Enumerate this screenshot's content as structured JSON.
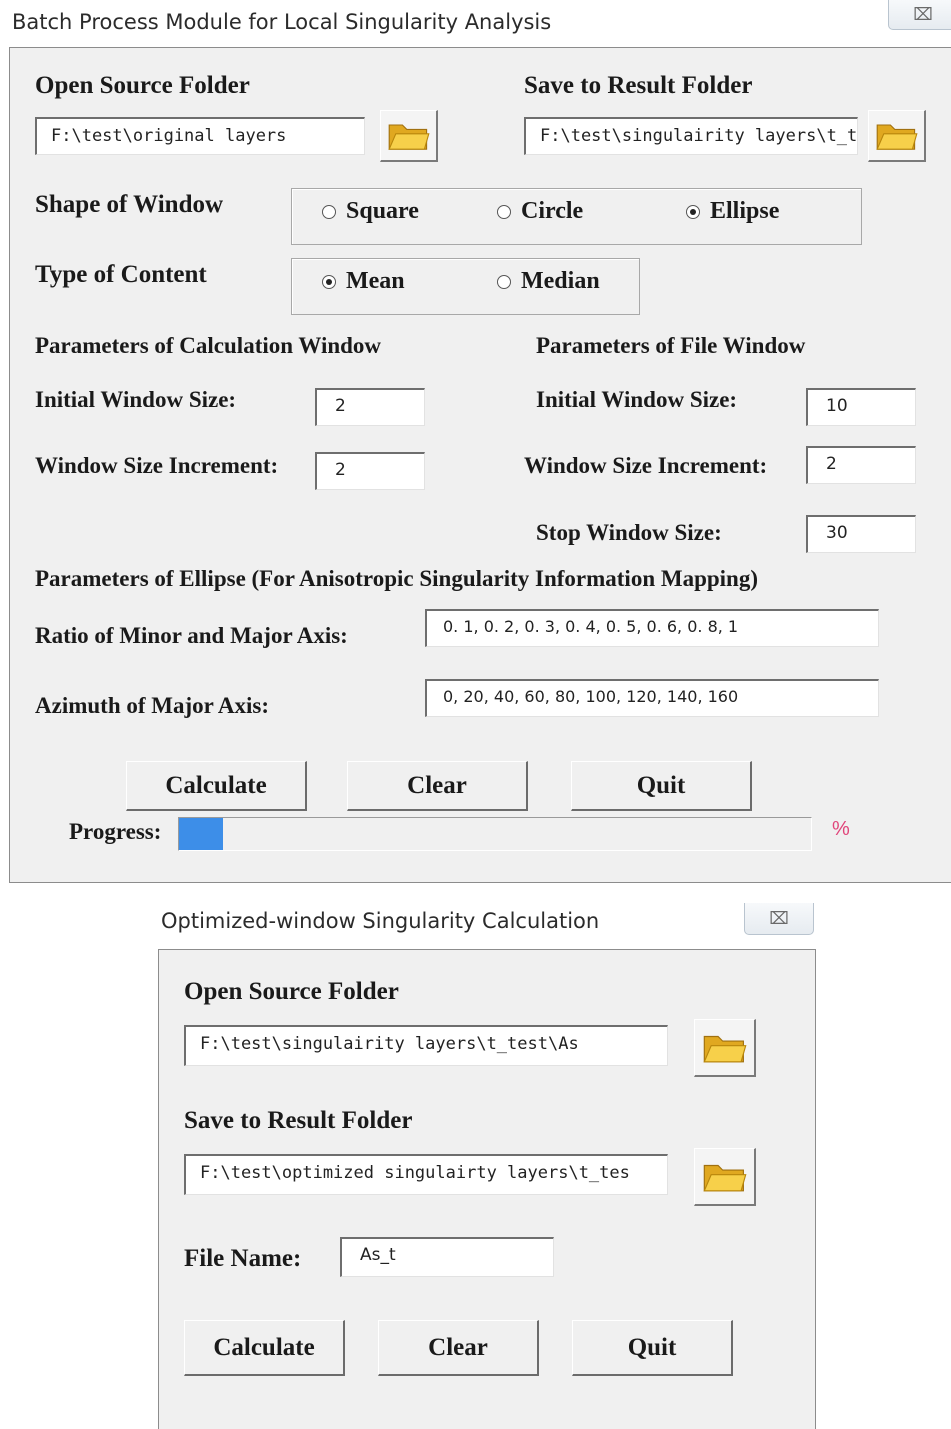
{
  "colors": {
    "panel_bg": "#f0f0f0",
    "progress_fill": "#3d8ee8",
    "percent_text": "#e0457a",
    "folder_icon": "#f2c23a"
  },
  "batch_window": {
    "title": "Batch Process Module for Local Singularity Analysis",
    "close_glyph": "⌧",
    "open_source_label": "Open Source Folder",
    "open_source_path": "F:\\test\\original layers",
    "save_result_label": "Save to Result Folder",
    "save_result_path": "F:\\test\\singulairity layers\\t_t",
    "folder_icon": "folder-icon",
    "shape_label": "Shape of Window",
    "shape_options": [
      {
        "label": "Square",
        "selected": false
      },
      {
        "label": "Circle",
        "selected": false
      },
      {
        "label": "Ellipse",
        "selected": true
      }
    ],
    "content_label": "Type of Content",
    "content_options": [
      {
        "label": "Mean",
        "selected": true
      },
      {
        "label": "Median",
        "selected": false
      }
    ],
    "calc_window_header": "Parameters of Calculation Window",
    "file_window_header": "Parameters of File Window",
    "calc_initial_label": "Initial Window Size:",
    "calc_initial_value": "2",
    "calc_increment_label": "Window Size Increment:",
    "calc_increment_value": "2",
    "file_initial_label": "Initial Window Size:",
    "file_initial_value": "10",
    "file_increment_label": "Window Size Increment:",
    "file_increment_value": "2",
    "file_stop_label": "Stop Window Size:",
    "file_stop_value": "30",
    "ellipse_header": "Parameters of Ellipse (For Anisotropic Singularity Information Mapping)",
    "ratio_label": "Ratio of Minor and Major Axis:",
    "ratio_value": "0. 1, 0. 2, 0. 3, 0. 4, 0. 5, 0. 6, 0. 8, 1",
    "azimuth_label": "Azimuth of Major Axis:",
    "azimuth_value": "0, 20, 40, 60, 80, 100, 120, 140, 160",
    "calculate_label": "Calculate",
    "clear_label": "Clear",
    "quit_label": "Quit",
    "progress_label": "Progress:",
    "progress_fraction": 0.07,
    "percent_sign": "%"
  },
  "optimized_window": {
    "title": "Optimized-window Singularity Calculation",
    "close_glyph": "⌧",
    "open_source_label": "Open Source Folder",
    "open_source_path": "F:\\test\\singulairity layers\\t_test\\As",
    "save_result_label": "Save to Result Folder",
    "save_result_path": "F:\\test\\optimized singulairty layers\\t_tes",
    "file_name_label": "File Name:",
    "file_name_value": "As_t",
    "calculate_label": "Calculate",
    "clear_label": "Clear",
    "quit_label": "Quit"
  }
}
